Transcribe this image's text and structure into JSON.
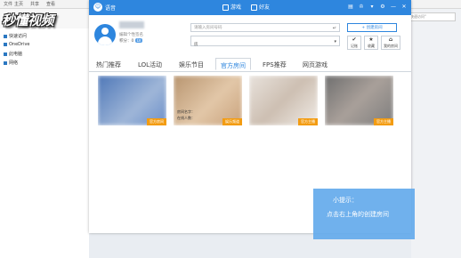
{
  "explorer": {
    "menu": [
      "文件",
      "主页",
      "共享",
      "查看"
    ],
    "sidebar": [
      "快速访问",
      "OneDrive",
      "此电脑",
      "网络"
    ],
    "search_placeholder": "搜索\"快速访问\""
  },
  "watermark": "秒懂视频",
  "app": {
    "title": "语音",
    "nav": [
      {
        "label": "游戏",
        "icon": "gamepad-icon"
      },
      {
        "label": "好友",
        "icon": "friends-icon"
      }
    ],
    "title_buttons": [
      "menu-icon",
      "shirt-icon",
      "minimize-icon",
      "settings-icon",
      "min-icon",
      "close-icon"
    ]
  },
  "profile": {
    "signature": "编辑个性签名",
    "level_label": "积分：",
    "level_value": "0",
    "badge": "LV"
  },
  "room": {
    "input_placeholder": "请输入房间号码",
    "enter_icon": "↵",
    "select_prefix": "房",
    "create_label": "+ 创建房间",
    "buttons": [
      {
        "icon": "✔",
        "label": "记账"
      },
      {
        "icon": "★",
        "label": "收藏"
      },
      {
        "icon": "⌂",
        "label": "我的房间"
      }
    ]
  },
  "tabs": [
    "热门推荐",
    "LOL活动",
    "娱乐节目",
    "官方房间",
    "FPS推荐",
    "网页游戏"
  ],
  "active_tab": 3,
  "cards": [
    {
      "tag": "官方房间",
      "color": "#6b8fc9"
    },
    {
      "tag": "娱乐频道",
      "meta1": "房间名字：",
      "meta2": "在线人数：",
      "color": "#c9a27c"
    },
    {
      "tag": "官方主播",
      "color": "#d8cfc6"
    },
    {
      "tag": "官方主播",
      "color": "#8a8a8a"
    }
  ],
  "tip": {
    "title": "小提示：",
    "body": "点击右上角的创建房间"
  }
}
